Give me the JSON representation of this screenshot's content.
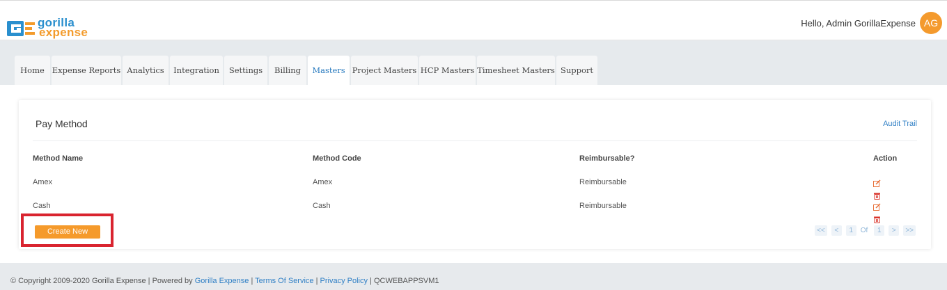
{
  "brand": {
    "line1": "gorilla",
    "line2": "expense",
    "colors": {
      "blue": "#2a8fce",
      "orange": "#f39b2c"
    }
  },
  "header": {
    "greeting": "Hello, Admin GorillaExpense",
    "avatar_initials": "AG",
    "avatar_color": "#f49a2d"
  },
  "tabs": [
    {
      "label": "Home"
    },
    {
      "label": "Expense Reports"
    },
    {
      "label": "Analytics"
    },
    {
      "label": "Integration"
    },
    {
      "label": "Settings"
    },
    {
      "label": "Billing"
    },
    {
      "label": "Masters",
      "active": true
    },
    {
      "label": "Project Masters"
    },
    {
      "label": "HCP Masters"
    },
    {
      "label": "Timesheet Masters"
    },
    {
      "label": "Support"
    }
  ],
  "card": {
    "title": "Pay Method",
    "audit_link": "Audit Trail"
  },
  "table": {
    "columns": [
      "Method Name",
      "Method Code",
      "Reimbursable?",
      "Action"
    ],
    "rows": [
      {
        "name": "Amex",
        "code": "Amex",
        "reimbursable": "Reimbursable",
        "actions": [
          "edit-icon",
          "delete-icon"
        ]
      },
      {
        "name": "Cash",
        "code": "Cash",
        "reimbursable": "Reimbursable",
        "actions": [
          "edit-icon",
          "delete-icon"
        ]
      }
    ]
  },
  "create_button": "Create New",
  "pagination": {
    "first": "<<",
    "prev": "<",
    "current": "1",
    "of": "Of",
    "total": "1",
    "next": ">",
    "last": ">>"
  },
  "footer": {
    "copyright": "© Copyright 2009-2020 Gorilla Expense | Powered by",
    "powered_link": "Gorilla Expense",
    "sep": "|",
    "terms": "Terms Of Service",
    "privacy": "Privacy Policy",
    "server": "QCWEBAPPSVM1"
  },
  "colors": {
    "accent": "#f59a2b",
    "link": "#2f7fc5",
    "highlight_border": "#d9242f"
  }
}
